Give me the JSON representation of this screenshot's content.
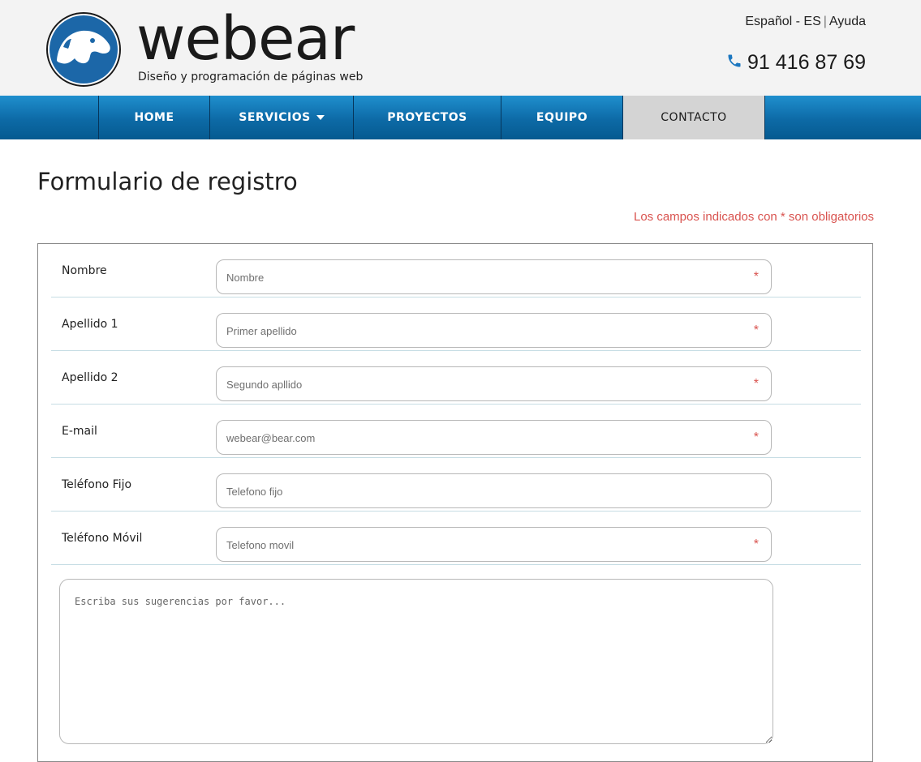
{
  "brand": {
    "name": "webear",
    "tagline": "Diseño y programación de páginas web"
  },
  "toplinks": {
    "language": "Español - ES",
    "separator": "|",
    "help": "Ayuda"
  },
  "phone": {
    "number": "91 416 87 69",
    "icon": "phone-icon"
  },
  "nav": {
    "items": [
      {
        "label": "HOME"
      },
      {
        "label": "SERVICIOS"
      },
      {
        "label": "PROYECTOS"
      },
      {
        "label": "EQUIPO"
      },
      {
        "label": "CONTACTO",
        "active": true
      }
    ]
  },
  "page": {
    "title": "Formulario de registro",
    "required_note": "Los campos indicados con * son obligatorios"
  },
  "form": {
    "fields": [
      {
        "label": "Nombre",
        "placeholder": "Nombre",
        "required": true
      },
      {
        "label": "Apellido 1",
        "placeholder": "Primer apellido",
        "required": true
      },
      {
        "label": "Apellido 2",
        "placeholder": "Segundo apllido",
        "required": true
      },
      {
        "label": "E-mail",
        "placeholder": "webear@bear.com",
        "required": true
      },
      {
        "label": "Teléfono Fijo",
        "placeholder": "Telefono fijo",
        "required": false
      },
      {
        "label": "Teléfono Móvil",
        "placeholder": "Telefono movil",
        "required": true
      }
    ],
    "required_mark": "*",
    "suggestions_placeholder": "Escriba sus sugerencias por favor..."
  },
  "colors": {
    "nav_blue": "#0d6aa6",
    "active_tab": "#d4d4d4",
    "required_red": "#d9534f",
    "logo_blue": "#1c67a8"
  }
}
